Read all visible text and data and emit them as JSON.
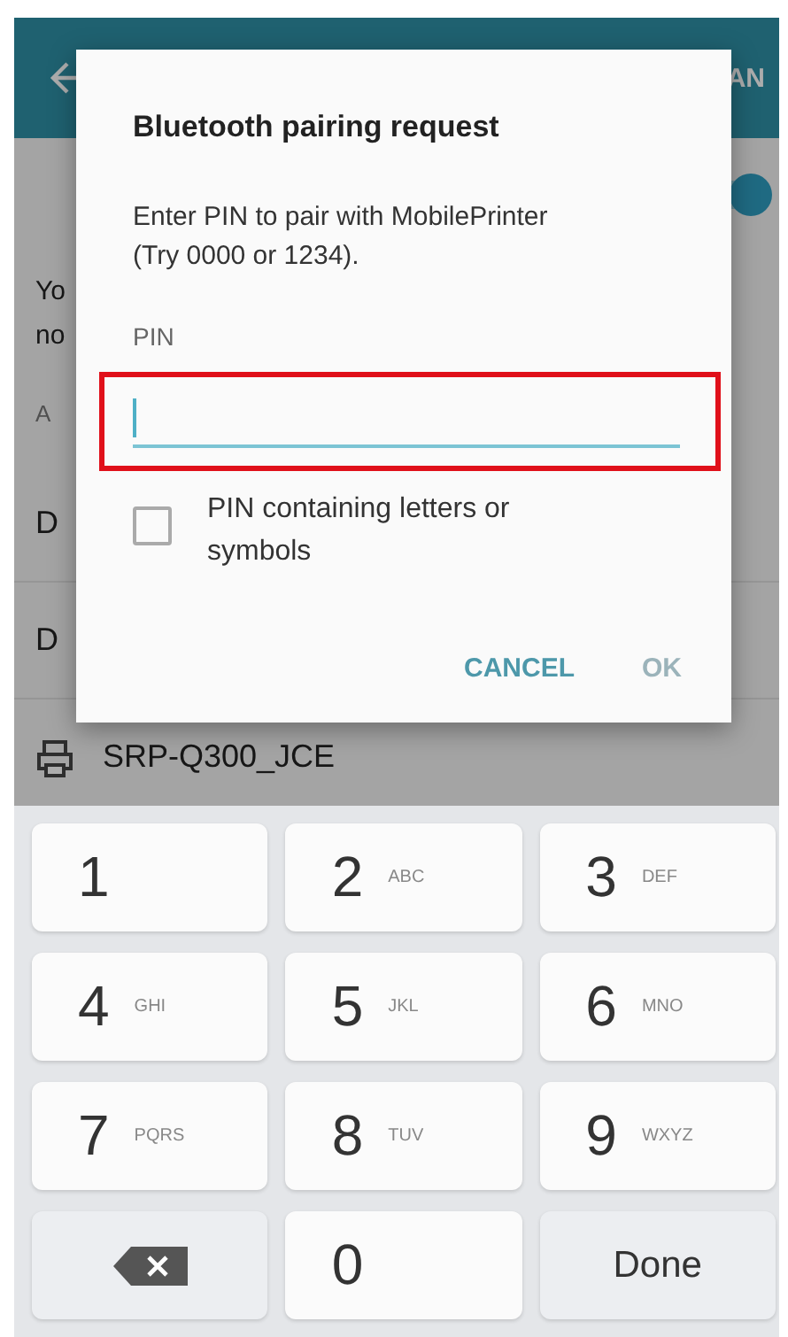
{
  "background": {
    "app_bar": {
      "action": "AN"
    },
    "toggle": {
      "on": true
    },
    "description": [
      "Yo",
      "no"
    ],
    "section": "A",
    "devices": [
      {
        "kind": "device",
        "label": "D"
      },
      {
        "kind": "device",
        "label": "D"
      },
      {
        "kind": "printer",
        "label": "SRP-Q300_JCE"
      }
    ]
  },
  "dialog": {
    "title": "Bluetooth pairing request",
    "message": "Enter PIN to pair with MobilePrinter (Try 0000 or 1234).",
    "field_label": "PIN",
    "field": {
      "focused": true,
      "highlighted": true
    },
    "checkbox": {
      "label": "PIN containing letters or symbols",
      "checked": false
    },
    "buttons": [
      {
        "label": "CANCEL",
        "disabled": false
      },
      {
        "label": "OK",
        "disabled": true
      }
    ]
  },
  "keyboard": {
    "keys": [
      {
        "kind": "digit",
        "digit": "1"
      },
      {
        "kind": "digit",
        "digit": "2",
        "letters": "ABC"
      },
      {
        "kind": "digit",
        "digit": "3",
        "letters": "DEF"
      },
      {
        "kind": "digit",
        "digit": "4",
        "letters": "GHI"
      },
      {
        "kind": "digit",
        "digit": "5",
        "letters": "JKL"
      },
      {
        "kind": "digit",
        "digit": "6",
        "letters": "MNO"
      },
      {
        "kind": "digit",
        "digit": "7",
        "letters": "PQRS"
      },
      {
        "kind": "digit",
        "digit": "8",
        "letters": "TUV"
      },
      {
        "kind": "digit",
        "digit": "9",
        "letters": "WXYZ"
      },
      {
        "kind": "backspace"
      },
      {
        "kind": "digit",
        "digit": "0"
      },
      {
        "kind": "action",
        "label": "Done"
      }
    ]
  }
}
